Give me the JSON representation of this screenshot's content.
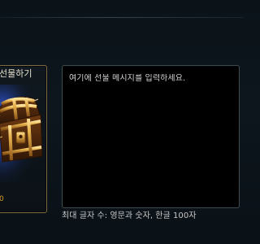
{
  "gift_panel": {
    "title": "선물하기",
    "value_fragment": "0",
    "icon": "treasure-chest-icon"
  },
  "message_box": {
    "placeholder": "여기에 선물 메시지를 입력하세요."
  },
  "char_limit": {
    "text": "최대 글자 수: 영문과 숫자, 한글 100자"
  },
  "colors": {
    "accent_gold": "#d89b2a",
    "panel_border": "#7e6941",
    "background": "#0b1319"
  }
}
